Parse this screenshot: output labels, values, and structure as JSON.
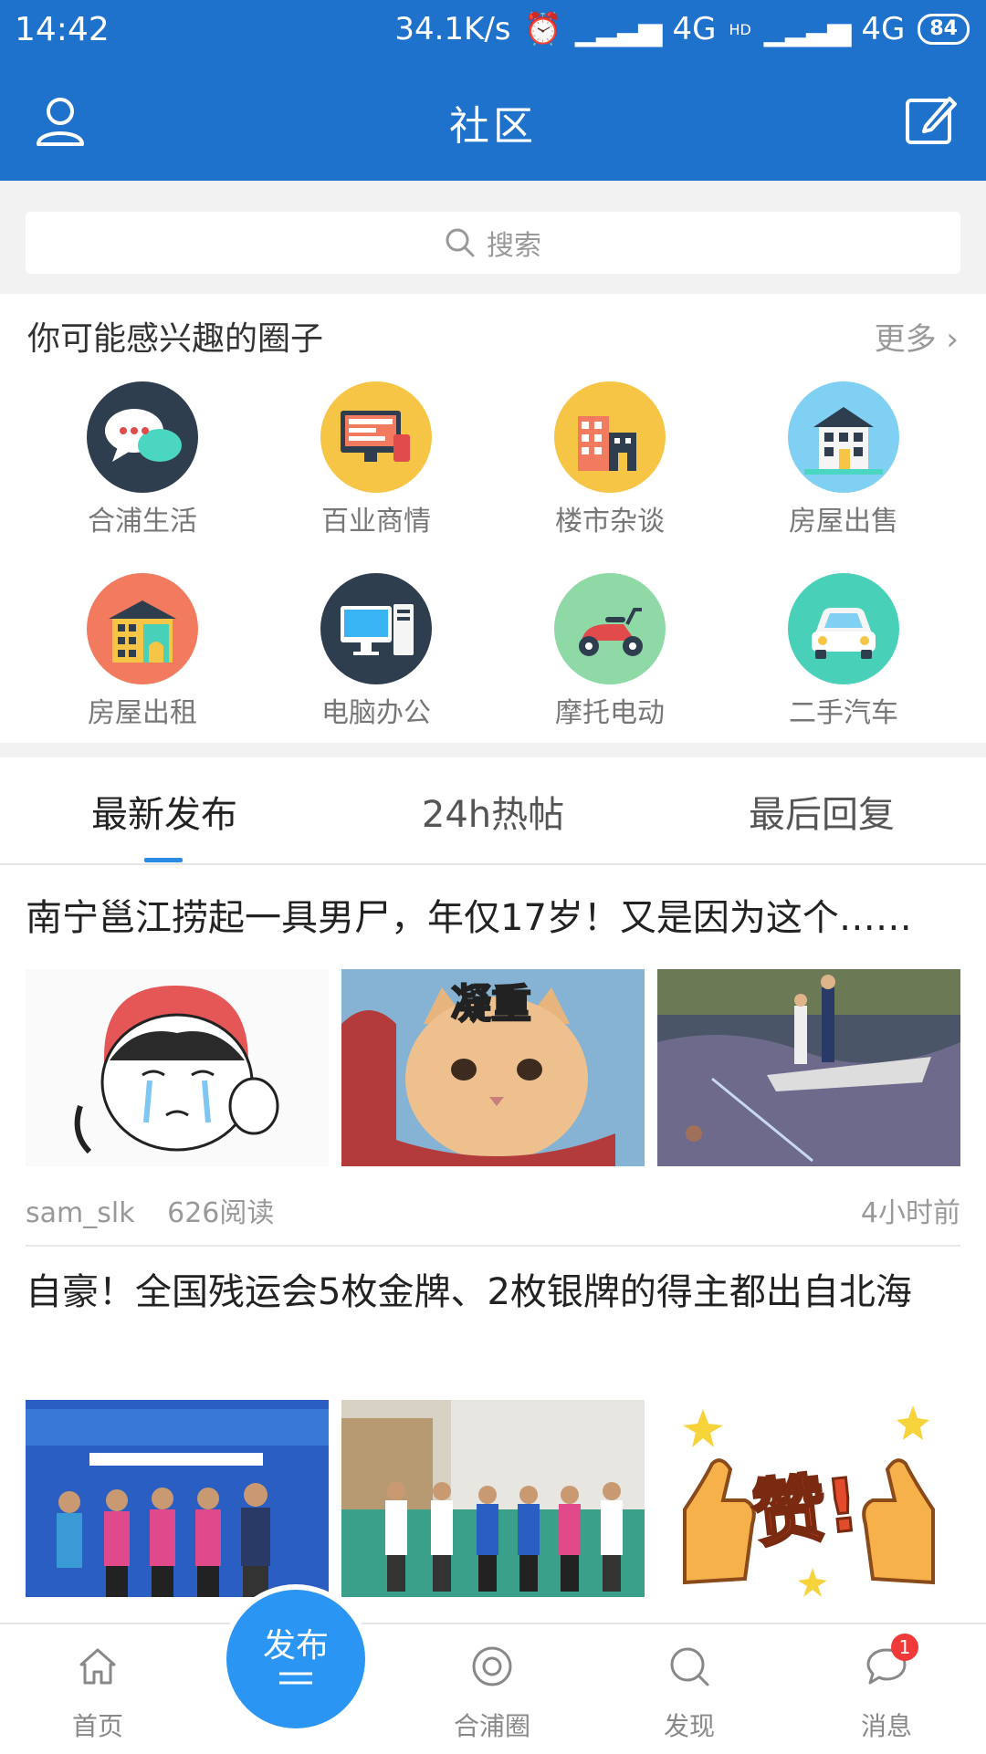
{
  "status": {
    "time": "14:42",
    "speed": "34.1K/s",
    "network1": "4G",
    "network2": "4G",
    "hd": "HD",
    "battery": "84"
  },
  "header": {
    "title": "社区"
  },
  "search": {
    "placeholder": "搜索"
  },
  "circles": {
    "section_title": "你可能感兴趣的圈子",
    "more_label": "更多",
    "items": [
      {
        "label": "合浦生活",
        "icon": "chat-bubbles-icon",
        "color": "#2e3e4f"
      },
      {
        "label": "百业商情",
        "icon": "monitor-shop-icon",
        "color": "#f6c545"
      },
      {
        "label": "楼市杂谈",
        "icon": "buildings-icon",
        "color": "#f6c545"
      },
      {
        "label": "房屋出售",
        "icon": "house-icon",
        "color": "#7fd0f2"
      },
      {
        "label": "房屋出租",
        "icon": "rental-building-icon",
        "color": "#f27a5e"
      },
      {
        "label": "电脑办公",
        "icon": "computer-icon",
        "color": "#2e3e4f"
      },
      {
        "label": "摩托电动",
        "icon": "scooter-icon",
        "color": "#8ed9a6"
      },
      {
        "label": "二手汽车",
        "icon": "car-icon",
        "color": "#48d1b8"
      }
    ]
  },
  "tabs": [
    {
      "label": "最新发布",
      "active": true
    },
    {
      "label": "24h热帖",
      "active": false
    },
    {
      "label": "最后回复",
      "active": false
    }
  ],
  "posts": [
    {
      "title": "南宁邕江捞起一具男尸，年仅17岁！又是因为这个……",
      "author": "sam_slk",
      "reads": "626阅读",
      "time": "4小时前",
      "images": [
        "crying-cartoon-girl",
        "serious-cat-凝重",
        "river-boat-rescue"
      ],
      "image_caption": "凝重"
    },
    {
      "title": "自豪！全国残运会5枚金牌、2枚银牌的得主都出自北海",
      "images": [
        "athletes-on-stage",
        "athletes-group-photo",
        "thumbs-up-赞"
      ],
      "image_caption": "赞!"
    }
  ],
  "bottom_nav": {
    "home": "首页",
    "publish": "发布",
    "circle": "合浦圈",
    "discover": "发现",
    "messages": "消息",
    "message_badge": "1"
  }
}
